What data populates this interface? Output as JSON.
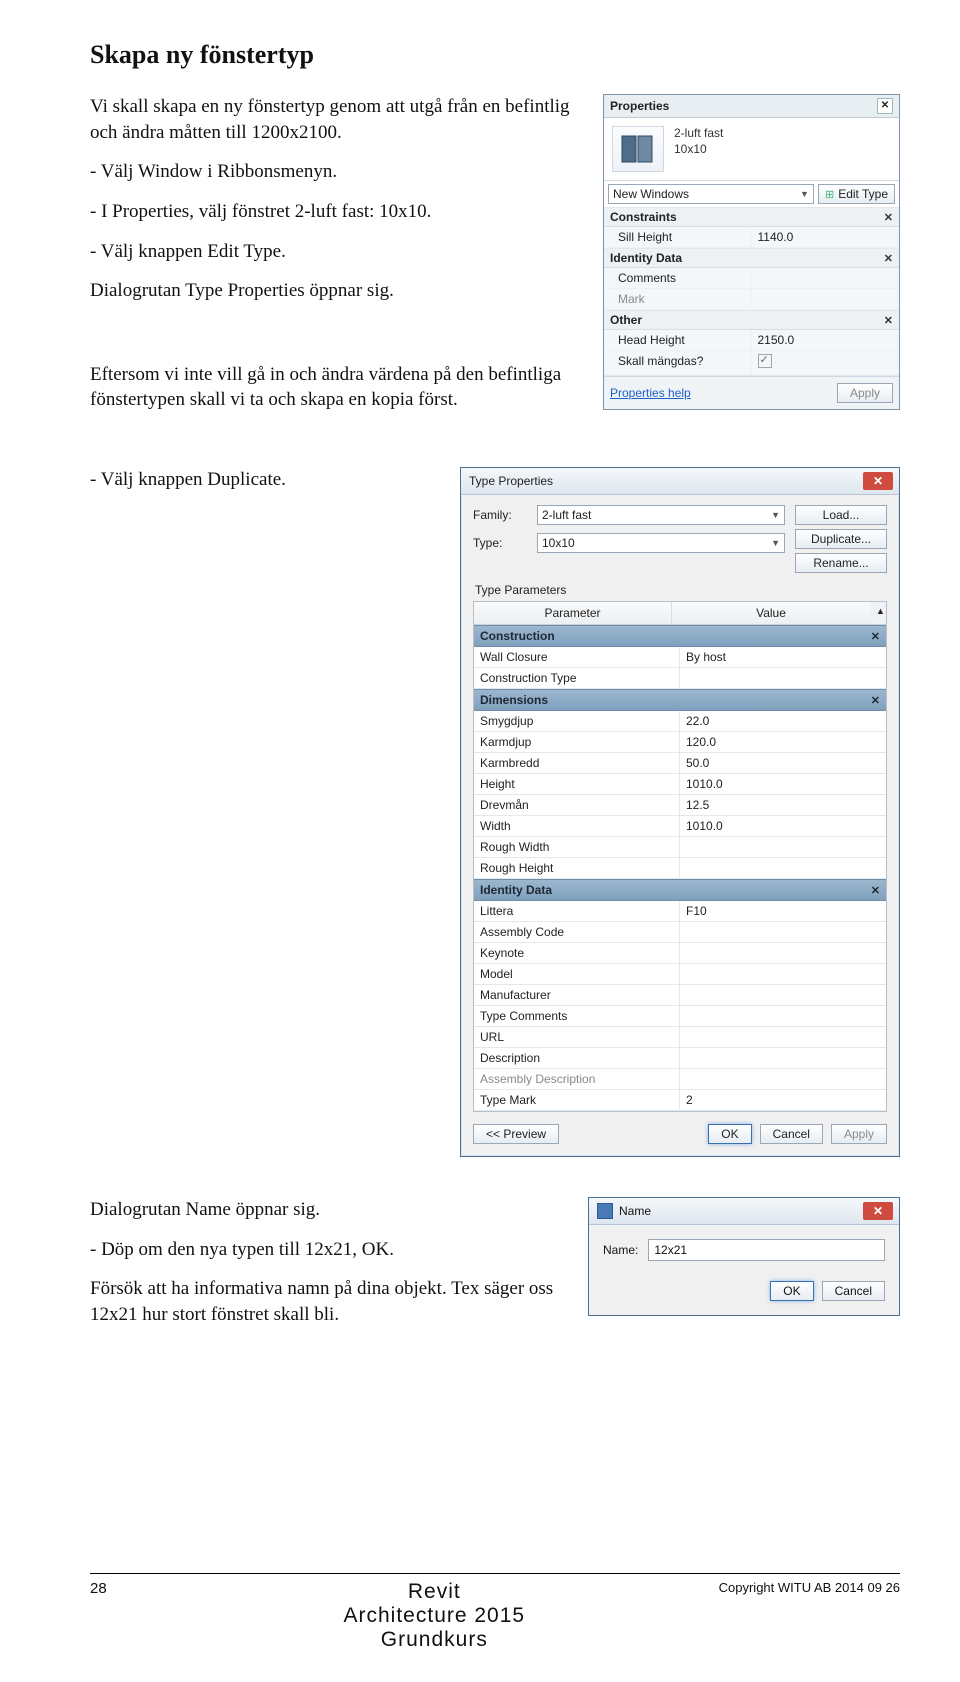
{
  "doc": {
    "title": "Skapa ny fönstertyp",
    "para_intro": "Vi skall skapa en ny fönstertyp genom att utgå från en befintlig och ändra måtten till 1200x2100.",
    "bullet1": "-  Välj Window i Ribbonsmenyn.",
    "bullet2": "-  I Properties, välj fönstret 2-luft fast: 10x10.",
    "bullet3": "-  Välj knappen Edit Type.",
    "para_dialog1": "Dialogrutan Type Properties öppnar sig.",
    "para_mid": "Eftersom vi inte vill gå in och ändra värdena på den befintliga fönstertypen skall vi ta och skapa en kopia först.",
    "bullet4": "-  Välj knappen Duplicate.",
    "para_dialog2": "Dialogrutan Name öppnar sig.",
    "bullet5": "-  Döp om den nya typen till 12x21, OK.",
    "para_note": "Försök att ha informativa namn på dina objekt. Tex säger oss 12x21 hur stort fönstret skall bli."
  },
  "properties": {
    "panel_title": "Properties",
    "type_name_line1": "2-luft fast",
    "type_name_line2": "10x10",
    "category_select": "New Windows",
    "edit_type": "Edit Type",
    "section_constraints": "Constraints",
    "sill_height_label": "Sill Height",
    "sill_height_value": "1140.0",
    "section_identity": "Identity Data",
    "comments_label": "Comments",
    "mark_label": "Mark",
    "section_other": "Other",
    "head_height_label": "Head Height",
    "head_height_value": "2150.0",
    "mangdas_label": "Skall mängdas?",
    "help_link": "Properties help",
    "apply": "Apply"
  },
  "typeprops": {
    "title": "Type Properties",
    "family_label": "Family:",
    "family_value": "2-luft fast",
    "type_label": "Type:",
    "type_value": "10x10",
    "load": "Load...",
    "duplicate": "Duplicate...",
    "rename": "Rename...",
    "tp_heading": "Type Parameters",
    "col_param": "Parameter",
    "col_value": "Value",
    "groups": [
      {
        "name": "Construction",
        "rows": [
          {
            "p": "Wall Closure",
            "v": "By host"
          },
          {
            "p": "Construction Type",
            "v": ""
          }
        ]
      },
      {
        "name": "Dimensions",
        "rows": [
          {
            "p": "Smygdjup",
            "v": "22.0"
          },
          {
            "p": "Karmdjup",
            "v": "120.0"
          },
          {
            "p": "Karmbredd",
            "v": "50.0"
          },
          {
            "p": "Height",
            "v": "1010.0"
          },
          {
            "p": "Drevmån",
            "v": "12.5"
          },
          {
            "p": "Width",
            "v": "1010.0"
          },
          {
            "p": "Rough Width",
            "v": ""
          },
          {
            "p": "Rough Height",
            "v": ""
          }
        ]
      },
      {
        "name": "Identity Data",
        "rows": [
          {
            "p": "Littera",
            "v": "F10"
          },
          {
            "p": "Assembly Code",
            "v": ""
          },
          {
            "p": "Keynote",
            "v": ""
          },
          {
            "p": "Model",
            "v": ""
          },
          {
            "p": "Manufacturer",
            "v": ""
          },
          {
            "p": "Type Comments",
            "v": ""
          },
          {
            "p": "URL",
            "v": ""
          },
          {
            "p": "Description",
            "v": ""
          },
          {
            "p": "Assembly Description",
            "v": "",
            "muted": true
          },
          {
            "p": "Type Mark",
            "v": "2"
          }
        ]
      }
    ],
    "preview": "<< Preview",
    "ok": "OK",
    "cancel": "Cancel",
    "apply": "Apply"
  },
  "namedlg": {
    "title": "Name",
    "label": "Name:",
    "value": "12x21",
    "ok": "OK",
    "cancel": "Cancel"
  },
  "footer": {
    "page": "28",
    "line1": "Revit",
    "line2": "Architecture 2015",
    "line3": "Grundkurs",
    "copyright": "Copyright WITU AB 2014 09 26"
  }
}
